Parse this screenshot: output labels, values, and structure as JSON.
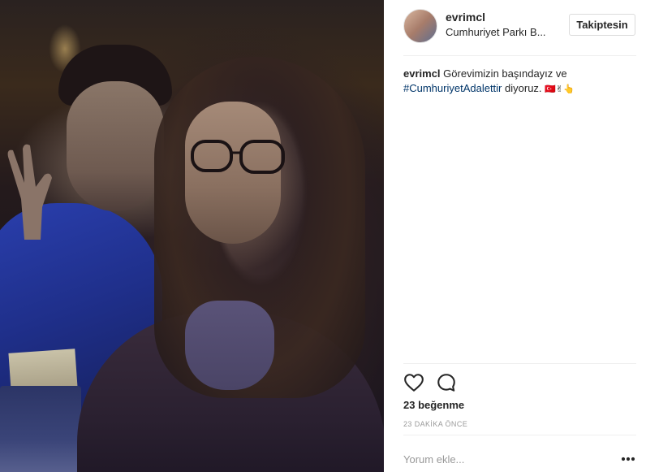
{
  "post": {
    "username": "evrimcl",
    "location": "Cumhuriyet Parkı B...",
    "follow_label": "Takiptesin",
    "caption": {
      "username": "evrimcl",
      "text_before": "Görevimizin başındayız ve",
      "hashtag": "#CumhuriyetAdalettir",
      "text_after": "diyoruz.",
      "emoji": "🇹🇷✌👆"
    },
    "likes_label": "23 beğenme",
    "timestamp": "23 DAKİKA ÖNCE",
    "comment_placeholder": "Yorum ekle...",
    "icons": {
      "like": "heart-icon",
      "comment": "comment-bubble-icon",
      "more": "more-options-icon"
    }
  },
  "colors": {
    "hashtag": "#003569",
    "text": "#262626",
    "muted": "#999999",
    "border": "#dbdbdb"
  }
}
